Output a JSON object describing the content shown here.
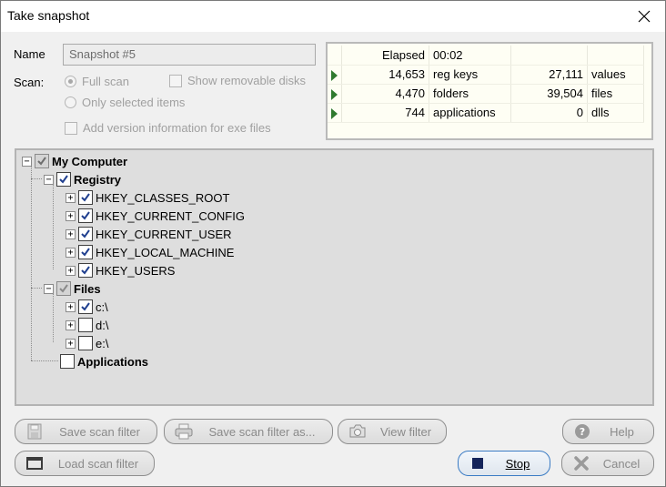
{
  "window": {
    "title": "Take snapshot"
  },
  "form": {
    "name_label": "Name",
    "name_value": "Snapshot #5",
    "scan_label": "Scan:",
    "full_scan": "Full scan",
    "only_selected": "Only selected items",
    "show_removable": "Show removable disks",
    "add_version": "Add version information for exe files"
  },
  "stats": {
    "elapsed_label": "Elapsed",
    "elapsed_value": "00:02",
    "rows": [
      {
        "count": "14,653",
        "label": "reg keys",
        "count2": "27,111",
        "label2": "values"
      },
      {
        "count": "4,470",
        "label": "folders",
        "count2": "39,504",
        "label2": "files"
      },
      {
        "count": "744",
        "label": "applications",
        "count2": "0",
        "label2": "dlls"
      }
    ]
  },
  "tree": {
    "my_computer": "My Computer",
    "registry": "Registry",
    "hkcr": "HKEY_CLASSES_ROOT",
    "hkcc": "HKEY_CURRENT_CONFIG",
    "hkcu": "HKEY_CURRENT_USER",
    "hklm": "HKEY_LOCAL_MACHINE",
    "hku": "HKEY_USERS",
    "files": "Files",
    "c": "c:\\",
    "d": "d:\\",
    "e": "e:\\",
    "applications": "Applications"
  },
  "buttons": {
    "save_filter": "Save scan filter",
    "save_filter_as": "Save scan filter as...",
    "view_filter": "View filter",
    "help": "Help",
    "load_filter": "Load scan filter",
    "stop": "Stop",
    "cancel": "Cancel"
  },
  "colors": {
    "arrow": "#2f7a2f",
    "stats_bg": "#fefef4",
    "tree_bg": "#dedede",
    "check": "#1f3f8f"
  }
}
